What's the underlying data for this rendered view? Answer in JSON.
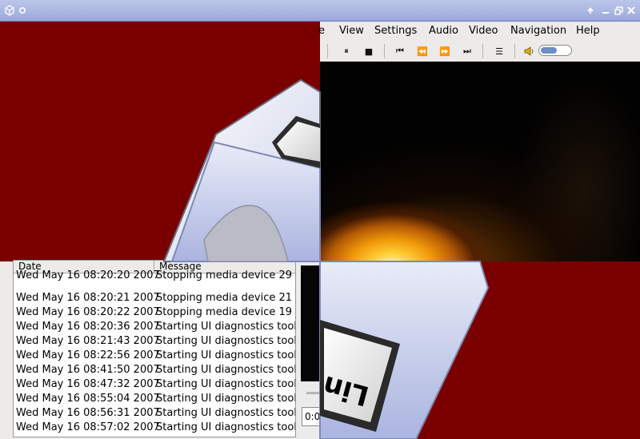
{
  "titlebar": {
    "app_icon": "cube-icon",
    "menu_icon": "circle-icon",
    "buttons": [
      "up-arrow-icon",
      "minimize-icon",
      "restore-icon",
      "close-icon"
    ]
  },
  "player": {
    "menu": [
      "e",
      "View",
      "Settings",
      "Audio",
      "Video",
      "Navigation",
      "Help"
    ],
    "toolbar": {
      "pause": "⏸",
      "stop": "■",
      "prev": "⏮",
      "rewind": "⏪",
      "forward": "⏩",
      "next": "⏭",
      "playlist": "☰",
      "volume_icon": "🔈",
      "volume_level": 0.55
    }
  },
  "log": {
    "columns": {
      "date": "Date",
      "message": "Message"
    },
    "rows": [
      {
        "date": "Wed May 16 08:20:20 2007",
        "message": "Stopping media device 29"
      },
      {
        "date": "Wed May 16 08:20:21 2007",
        "message": "Stopping media device 21"
      },
      {
        "date": "Wed May 16 08:20:22 2007",
        "message": "Stopping media device 19"
      },
      {
        "date": "Wed May 16 08:20:36 2007",
        "message": "Starting UI diagnostics tool"
      },
      {
        "date": "Wed May 16 08:21:43 2007",
        "message": "Starting UI diagnostics tool"
      },
      {
        "date": "Wed May 16 08:22:56 2007",
        "message": "Starting UI diagnostics tool"
      },
      {
        "date": "Wed May 16 08:41:50 2007",
        "message": "Starting UI diagnostics tool"
      },
      {
        "date": "Wed May 16 08:47:32 2007",
        "message": "Starting UI diagnostics tool"
      },
      {
        "date": "Wed May 16 08:55:04 2007",
        "message": "Starting UI diagnostics tool"
      },
      {
        "date": "Wed May 16 08:56:31 2007",
        "message": "Starting UI diagnostics tool"
      },
      {
        "date": "Wed May 16 08:57:02 2007",
        "message": "Starting UI diagnostics tool"
      }
    ],
    "time_field": "0:0"
  },
  "logo": {
    "text": "Lin"
  },
  "colors": {
    "desktop": "#7a0000",
    "titlebar": "#a9b5e2",
    "panel": "#ecebe9",
    "volume": "#6b8fc4"
  }
}
